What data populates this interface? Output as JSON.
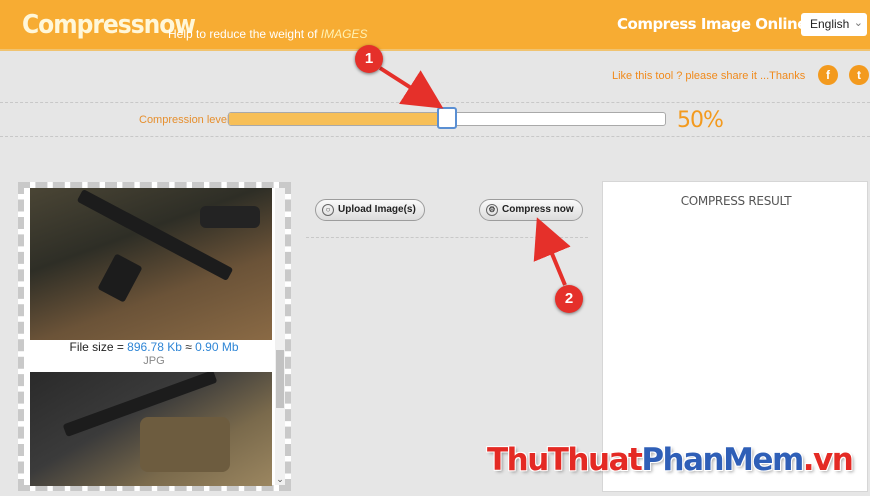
{
  "header": {
    "brand": "Compressnow",
    "tagline": "Help to reduce the weight of ",
    "tagline_emphasis": "IMAGES",
    "title": "Compress Image Online",
    "language": "English"
  },
  "share": {
    "text": "Like this tool ? please share it ...Thanks",
    "facebook_glyph": "f",
    "twitter_glyph": "t"
  },
  "slider": {
    "label": "Compression level",
    "value_text": "50%",
    "value_fraction": 0.5
  },
  "images": [
    {
      "file_size_label": "File size = ",
      "file_size_kb": "896.78 Kb",
      "approx": " ≈ ",
      "file_size_mb": "0.90 Mb",
      "format": "JPG"
    }
  ],
  "actions": {
    "upload_label": "Upload Image(s)",
    "compress_label": "Compress now"
  },
  "result": {
    "title": "COMPRESS RESULT"
  },
  "annotations": {
    "badge1": "1",
    "badge2": "2"
  },
  "watermark": {
    "part1": "ThuThuat",
    "part2": "PhanMem",
    "part3": ".vn"
  },
  "colors": {
    "header_bg": "#f7ac33",
    "accent": "#f39a1e",
    "link_blue": "#2f86d6",
    "badge_red": "#e5302a"
  }
}
